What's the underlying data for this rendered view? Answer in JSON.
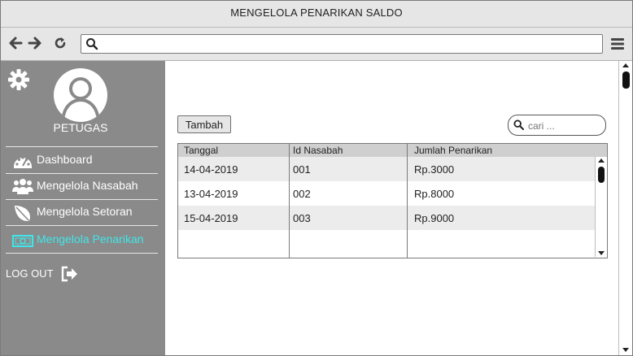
{
  "window": {
    "title": "MENGELOLA PENARIKAN SALDO"
  },
  "browser": {
    "url": "",
    "icons": [
      "arrow-left-icon",
      "arrow-right-icon",
      "refresh-icon",
      "search-icon",
      "hamburger-menu-icon"
    ]
  },
  "sidebar": {
    "role": "PETUGAS",
    "items": [
      {
        "label": "Dashboard",
        "icon": "dashboard-gauge-icon"
      },
      {
        "label": "Mengelola Nasabah",
        "icon": "users-icon"
      },
      {
        "label": "Mengelola Setoran",
        "icon": "leaf-icon"
      },
      {
        "label": "Mengelola Penarikan",
        "icon": "money-icon",
        "active": true
      }
    ],
    "logout": "LOG OUT"
  },
  "main": {
    "add_button": "Tambah",
    "search": {
      "placeholder": "cari ..."
    },
    "table": {
      "columns": [
        "Tanggal",
        "Id Nasabah",
        "Jumlah Penarikan"
      ],
      "rows": [
        [
          "14-04-2019",
          "001",
          "Rp.3000"
        ],
        [
          "13-04-2019",
          "002",
          "Rp.8000"
        ],
        [
          "15-04-2019",
          "003",
          "Rp.9000"
        ],
        [
          "",
          "",
          ""
        ]
      ]
    }
  },
  "colors": {
    "sidebar_bg": "#8a8a8a",
    "active_item": "#40e6ea",
    "chrome_bg": "#e6e6e6"
  }
}
